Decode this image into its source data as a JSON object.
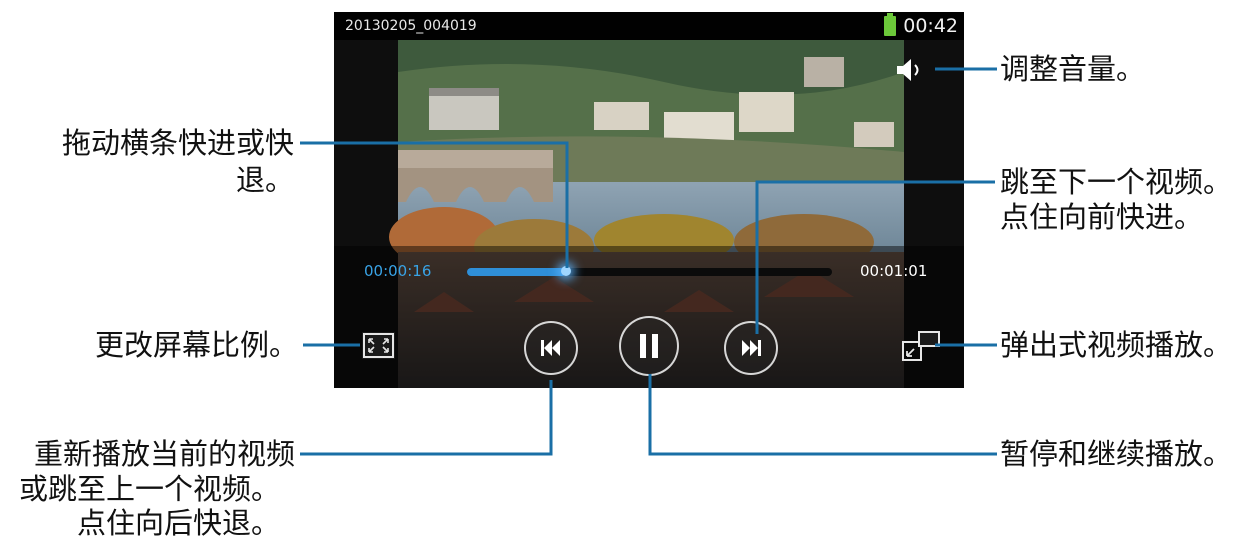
{
  "player": {
    "file_name": "20130205_004019",
    "clock": "00:42",
    "current_time": "00:00:16",
    "total_time": "00:01:01",
    "progress_fraction": 0.27,
    "accent_color": "#39a3e6",
    "battery_color": "#6cc83a"
  },
  "icons": {
    "volume": "volume-icon",
    "aspect_ratio": "aspect-ratio-icon",
    "previous": "skip-previous-icon",
    "pause": "pause-icon",
    "next": "skip-next-icon",
    "popup": "popup-player-icon",
    "battery": "battery-icon"
  },
  "callouts": {
    "volume": "调整音量。",
    "drag_line1": "拖动横条快进或快",
    "drag_line2": "退。",
    "next_line1": "跳至下一个视频。",
    "next_line2": "点住向前快进。",
    "ratio": "更改屏幕比例。",
    "popup": "弹出式视频播放。",
    "restart_line1": "重新播放当前的视频",
    "restart_line2": "或跳至上一个视频。",
    "restart_line3": "点住向后快退。",
    "pause": "暂停和继续播放。"
  }
}
